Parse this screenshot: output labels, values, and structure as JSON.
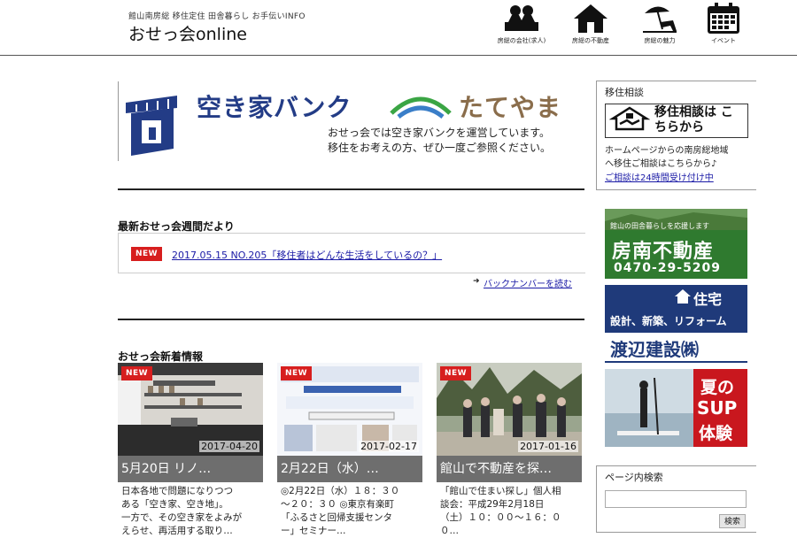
{
  "header": {
    "tagline": "館山南房総 移住定住 田舎暮らし お手伝いINFO",
    "title": "おせっ会online",
    "nav": [
      {
        "label": "房総の会社(求人)",
        "icon": "workers-icon"
      },
      {
        "label": "房総の不動産",
        "icon": "house-icon"
      },
      {
        "label": "房総の魅力",
        "icon": "beach-icon"
      },
      {
        "label": "イベント",
        "icon": "calendar-icon"
      }
    ]
  },
  "banner": {
    "title_left": "空き家バンク",
    "title_right": "たてやま",
    "desc_line1": "おせっ会では空き家バンクを運営しています。",
    "desc_line2": "移住をお考えの方、ぜひ一度ご参照ください。"
  },
  "newsletter": {
    "section_title": "最新おせっ会週間だより",
    "badge": "NEW",
    "item": "2017.05.15 NO.205「移住者はどんな生活をしているの？」",
    "back_numbers": "バックナンバーを読む"
  },
  "news": {
    "section_title": "おせっ会新着情報",
    "cards": [
      {
        "badge": "NEW",
        "date": "2017-04-20",
        "title": "5月20日 リノ…",
        "excerpt": [
          "日本各地で問題になりつつ",
          "ある「空き家、空き地」。",
          "一方で、その空き家をよみが",
          "えらせ、再活用する取り…"
        ]
      },
      {
        "badge": "NEW",
        "date": "2017-02-17",
        "title": "2月22日（水）…",
        "excerpt": [
          "◎2月22日（水）１８：３０",
          "～２０：３０ ◎東京有楽町",
          "「ふるさと回帰支援センタ",
          "ー」セミナー…"
        ]
      },
      {
        "badge": "NEW",
        "date": "2017-01-16",
        "title": "館山で不動産を探…",
        "excerpt": [
          "「館山で住まい探し」個人相",
          "談会：平成29年2月18日",
          "（土）１０：００～１６：０",
          "０…"
        ]
      }
    ]
  },
  "sidebar": {
    "consult_title": "移住相談",
    "consult_button": "移住相談は こちらから",
    "consult_line1": "ホームページからの南房総地域",
    "consult_line2": "へ移住ご相談はこちらから♪",
    "consult_line3": "ご相談は24時間受け付け中",
    "ad1_top": "館山の田舎暮らしを応援します",
    "ad1_name": "房南不動産",
    "ad1_phone": "0470-29-5209",
    "ad2_top": "住宅",
    "ad2_mid": "設計、新築、リフォーム",
    "ad2_name": "渡辺建設㈱",
    "ad3_line1": "夏の",
    "ad3_line2": "SUP",
    "ad3_line3": "体験",
    "search_title": "ページ内検索",
    "search_placeholder": "",
    "search_button": "検索"
  },
  "colors": {
    "new_badge": "#d71e1e",
    "banner_blue": "#233c86",
    "banner_brown": "#8a6d4b",
    "ad1_green": "#2f7a2f",
    "ad2_blue": "#1f3a7a",
    "ad3_red": "#c9171e"
  }
}
